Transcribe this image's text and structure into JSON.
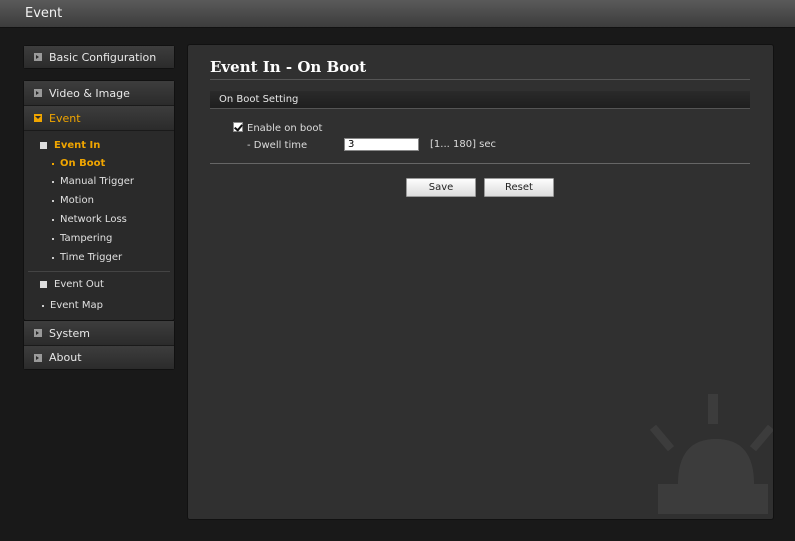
{
  "window": {
    "title": "Event"
  },
  "sidebar": {
    "basic_configuration": "Basic Configuration",
    "video_image": "Video & Image",
    "event": "Event",
    "event_in": "Event In",
    "event_in_items": [
      "On Boot",
      "Manual Trigger",
      "Motion",
      "Network Loss",
      "Tampering",
      "Time Trigger"
    ],
    "event_out": "Event Out",
    "event_map": "Event Map",
    "system": "System",
    "about": "About"
  },
  "main": {
    "title": "Event In - On Boot",
    "section_title": "On Boot Setting",
    "enable_label": "Enable on boot",
    "enable_checked": true,
    "dwell_label": "- Dwell time",
    "dwell_value": "3",
    "dwell_range": "[1... 180] sec",
    "save_label": "Save",
    "reset_label": "Reset"
  },
  "colors": {
    "accent": "#f0a500",
    "background": "#191919",
    "panel": "#303030"
  },
  "icons": {
    "collapsed": "expand-box-icon",
    "expanded": "collapse-box-icon",
    "watermark": "siren-icon"
  }
}
